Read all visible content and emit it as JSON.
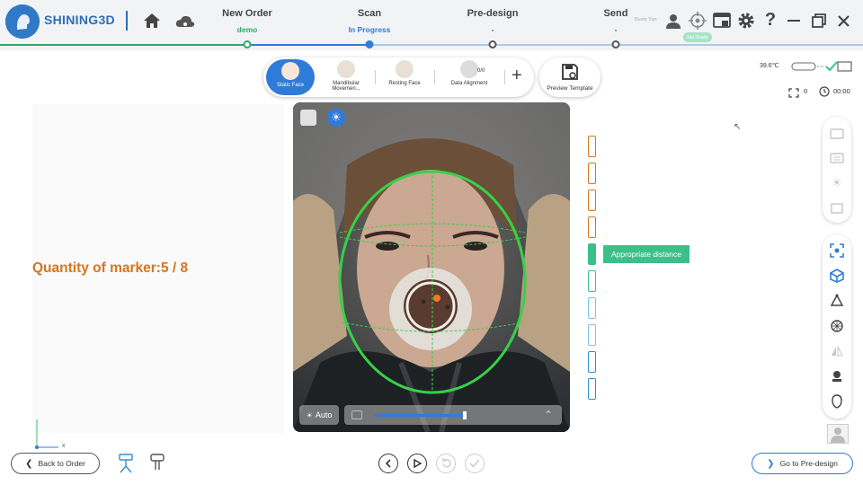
{
  "app": {
    "brand": "SHINING3D"
  },
  "workflow": {
    "steps": [
      {
        "title": "New Order",
        "sub": "demo",
        "color": "#2fa86b"
      },
      {
        "title": "Scan",
        "sub": "In Progress",
        "color": "#2f7bd8"
      },
      {
        "title": "Pre-design",
        "sub": "-",
        "color": "#555555"
      },
      {
        "title": "Send",
        "sub": "-",
        "color": "#555555"
      }
    ]
  },
  "header": {
    "user": "Busty Yan",
    "badge": "Not Ready"
  },
  "status": {
    "temperature": "39.6℃",
    "counter": "0",
    "timer": "00:00"
  },
  "modes": [
    {
      "label": "Static Face",
      "active": true
    },
    {
      "label": "Mandibular Movemen...",
      "active": false
    },
    {
      "label": "Resting Face",
      "active": false
    },
    {
      "label": "Data Alignment",
      "active": false,
      "badge": "0/0"
    }
  ],
  "add_label": "+",
  "preview_label": "Preview Template",
  "marker": {
    "label": "Quantity of marker:",
    "value": "5 / 8"
  },
  "distance": {
    "label": "Appropriate distance"
  },
  "camera": {
    "auto_label": "Auto"
  },
  "axis": {
    "x": "x"
  },
  "buttons": {
    "back": "Back to Order",
    "next": "Go to Pre-design"
  },
  "colors": {
    "accent": "#2f7bd8",
    "green": "#3cc08a",
    "orange": "#d4761f"
  }
}
